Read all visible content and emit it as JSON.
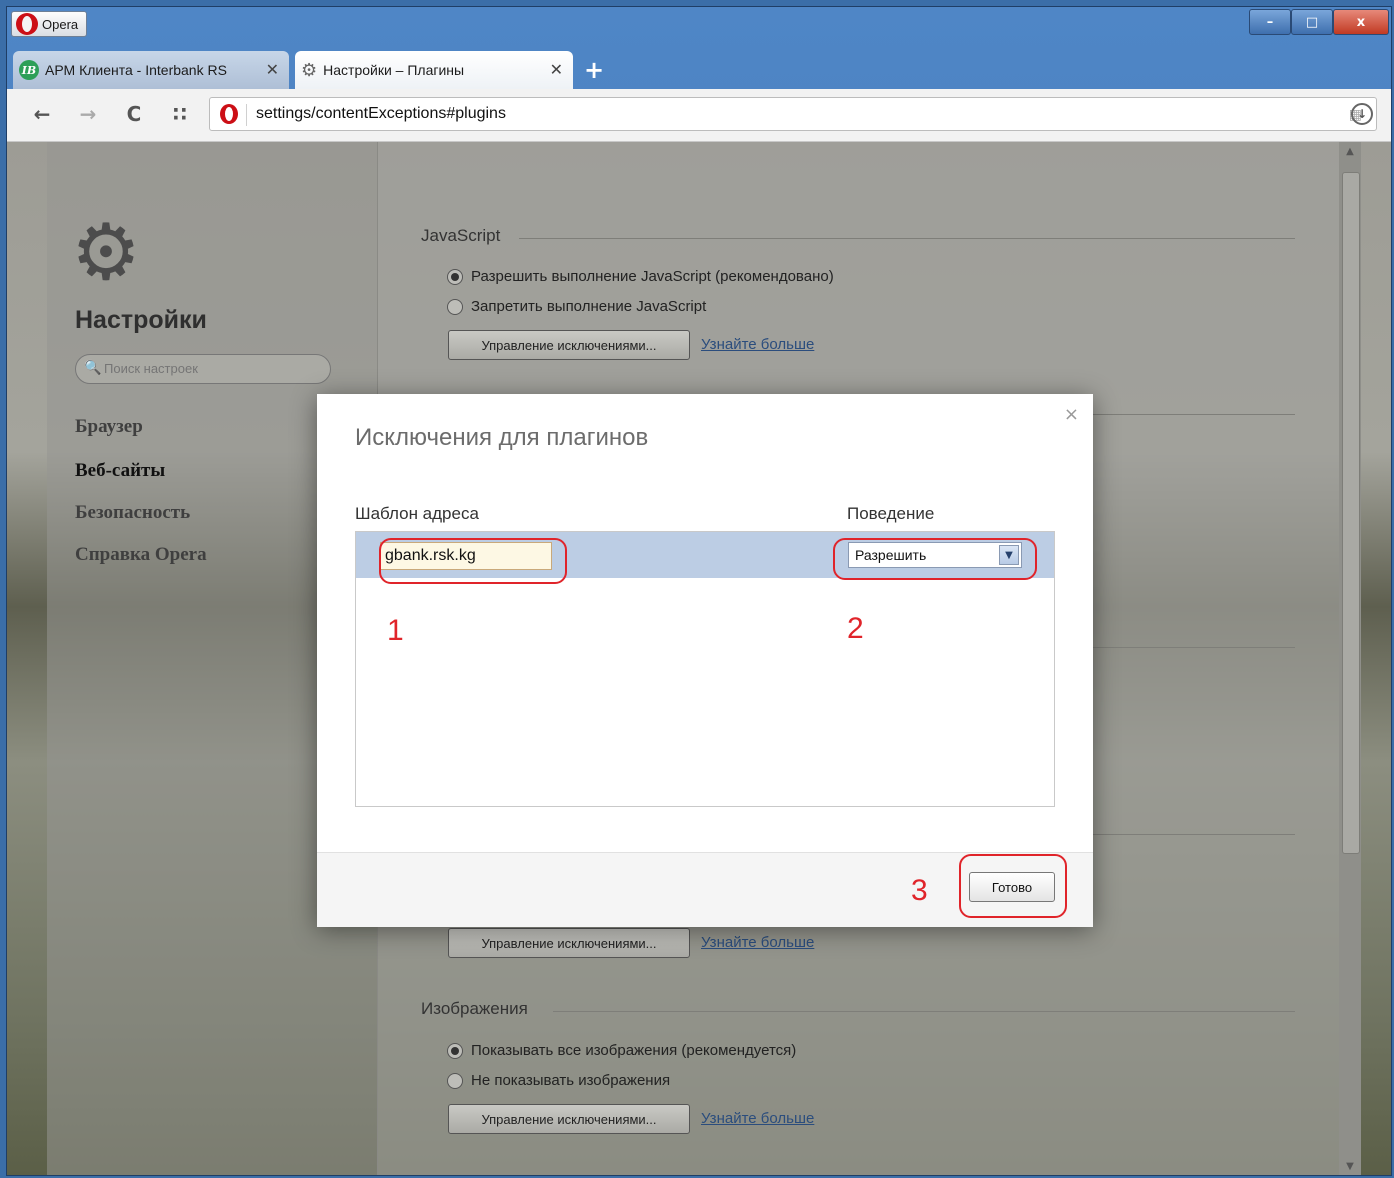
{
  "titlebar": {
    "menu_label": "Opera",
    "minimize": "–",
    "maximize": "□",
    "close": "x"
  },
  "tabs": [
    {
      "label": "АРМ Клиента - Interbank RS",
      "close": "✕"
    },
    {
      "label": "Настройки – Плагины",
      "close": "✕"
    }
  ],
  "newtab": "+",
  "toolbar": {
    "back": "←",
    "forward": "→",
    "reload": "C",
    "speeddial": "∷",
    "address": "settings/contentExceptions#plugins",
    "download": "↓"
  },
  "sidebar": {
    "title": "Настройки",
    "search_placeholder": "Поиск настроек",
    "items": [
      "Браузер",
      "Веб-сайты",
      "Безопасность",
      "Справка Opera"
    ],
    "active_index": 1
  },
  "content": {
    "javascript": {
      "heading": "JavaScript",
      "options": [
        "Разрешить выполнение JavaScript (рекомендовано)",
        "Запретить выполнение JavaScript"
      ],
      "selected": 0,
      "manage": "Управление исключениями...",
      "learn": "Узнайте больше"
    },
    "plugins_manage": "Управление исключениями...",
    "plugins_learn": "Узнайте больше",
    "images": {
      "heading": "Изображения",
      "options": [
        "Показывать все изображения (рекомендуется)",
        "Не показывать изображения"
      ],
      "selected": 0,
      "manage": "Управление исключениями...",
      "learn": "Узнайте больше"
    }
  },
  "modal": {
    "title": "Исключения для плагинов",
    "close": "×",
    "col_pattern": "Шаблон адреса",
    "col_behavior": "Поведение",
    "rows": [
      {
        "pattern": "gbank.rsk.kg",
        "behavior": "Разрешить"
      }
    ],
    "done": "Готово"
  },
  "annotations": {
    "n1": "1",
    "n2": "2",
    "n3": "3"
  }
}
